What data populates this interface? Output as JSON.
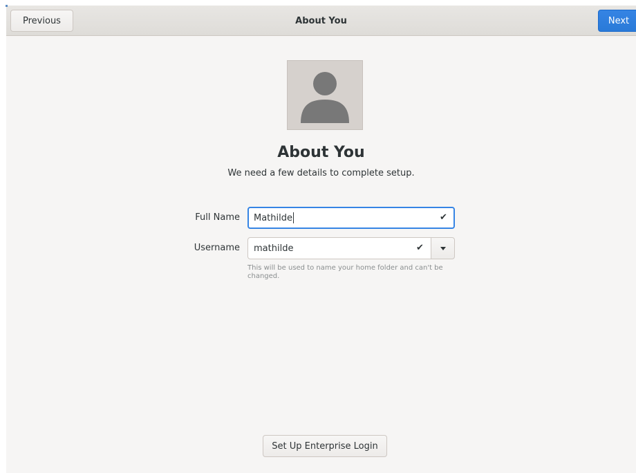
{
  "headerbar": {
    "previous_label": "Previous",
    "title": "About You",
    "next_label": "Next"
  },
  "avatar": {
    "icon": "user-avatar-icon"
  },
  "main": {
    "heading": "About You",
    "subtitle": "We need a few details to complete setup."
  },
  "form": {
    "full_name_label": "Full Name",
    "full_name_value": "Mathilde",
    "username_label": "Username",
    "username_value": "mathilde",
    "check_glyph": "✔",
    "username_hint": "This will be used to name your home folder and can't be changed."
  },
  "footer": {
    "enterprise_label": "Set Up Enterprise Login"
  },
  "colors": {
    "accent": "#3584e4",
    "background": "#f6f5f4",
    "text": "#2e3436"
  }
}
